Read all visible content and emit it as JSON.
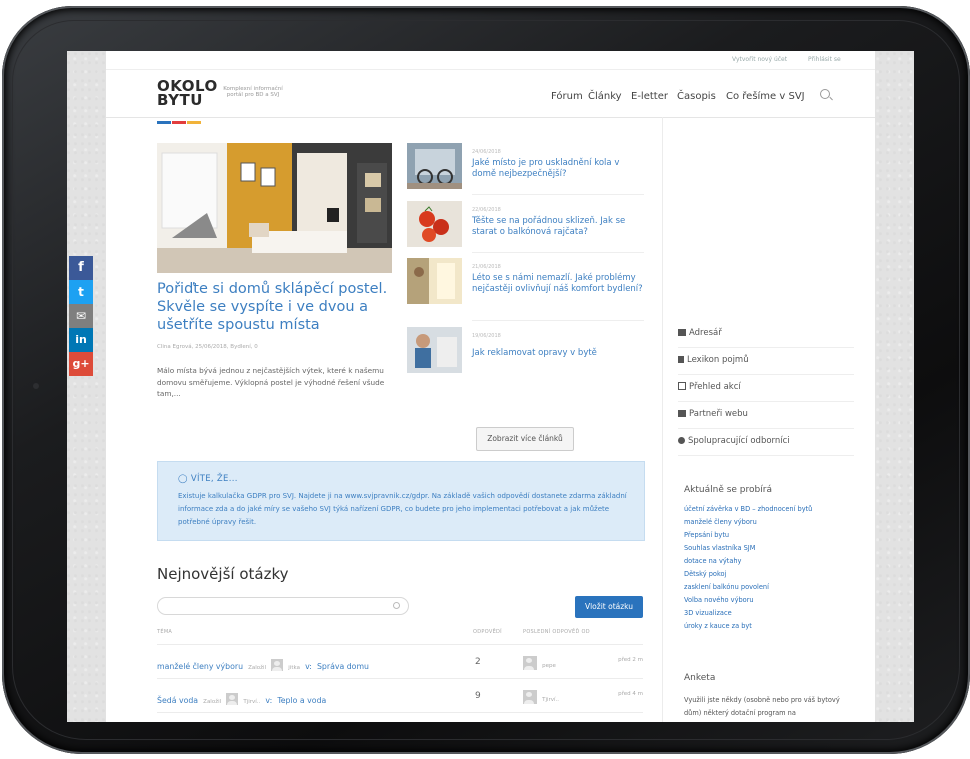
{
  "colors": {
    "accent": "#3d7fc1",
    "button": "#2a73bd",
    "info_bg": "#dcebf8"
  },
  "topbar": {
    "register": "Vytvořit nový účet",
    "login": "Přihlásit se"
  },
  "header": {
    "logo_line1": "OKOLO",
    "logo_line2": "BYTU",
    "tagline": "Komplexní informační portál pro BD a SVJ",
    "nav": [
      "Fórum",
      "Články",
      "E-letter",
      "Časopis",
      "Co řešíme v SVJ"
    ]
  },
  "featured": {
    "title": "Pořiďte si domů sklápěcí postel. Skvěle se vyspíte i ve dvou a ušetříte spoustu místa",
    "meta": "Clina Egrová, 25/06/2018, Bydlení, 0",
    "excerpt": "Málo místa bývá jednou z nejčastějších výtek, které k našemu domovu směřujeme. Výklopná postel je výhodné řešení všude tam,..."
  },
  "articles": [
    {
      "date": "24/06/2018",
      "title": "Jaké místo je pro uskladnění kola v domě nejbezpečnější?"
    },
    {
      "date": "22/06/2018",
      "title": "Těšte se na pořádnou sklizeň. Jak se starat o balkónová rajčata?"
    },
    {
      "date": "21/06/2018",
      "title": "Léto se s námi nemazlí. Jaké problémy nejčastěji ovlivňují náš komfort bydlení?"
    },
    {
      "date": "19/06/2018",
      "title": "Jak reklamovat opravy v bytě"
    }
  ],
  "more_button": "Zobrazit více článků",
  "info": {
    "title": "VÍTE, ŽE...",
    "text": "Existuje kalkulačka GDPR pro SVJ. Najdete ji na www.svjpravnik.cz/gdpr. Na základě vašich odpovědí dostanete zdarma základní informace zda a do jaké míry se vašeho SVJ týká nařízení GDPR, co budete pro jeho implementaci potřebovat a jak můžete potřebné úpravy řešit."
  },
  "questions": {
    "title": "Nejnovější otázky",
    "button": "Vložit otázku",
    "headers": {
      "topic": "TÉMA",
      "answers": "ODPOVĚDÍ",
      "last": "POSLEDNÍ ODPOVĚĎ OD"
    },
    "rows": [
      {
        "topic": "manželé členy výboru",
        "started_by": "Založil",
        "author": "jitka",
        "in": "v:",
        "forum": "Správa domu",
        "answers": "2",
        "last_user": "pepe",
        "ago": "před 2 m"
      },
      {
        "topic": "Šedá voda",
        "started_by": "Založil",
        "author": "Tjirví..",
        "in": "v:",
        "forum": "Teplo a voda",
        "answers": "9",
        "last_user": "Tjirví..",
        "ago": "před 4 m"
      }
    ]
  },
  "sidebar": {
    "links": [
      "Adresář",
      "Lexikon pojmů",
      "Přehled akcí",
      "Partneři webu",
      "Spolupracující odborníci"
    ],
    "trending_title": "Aktuálně se probírá",
    "trending": [
      "účetní závěrka v BD – zhodnocení bytů",
      "manželé členy výboru",
      "Přepsání bytu",
      "Souhlas vlastníka SJM",
      "dotace na výtahy",
      "Dětský pokoj",
      "zasklení balkónu povolení",
      "Volba nového výboru",
      "3D vizualizace",
      "úroky z kauce za byt"
    ],
    "poll_title": "Anketa",
    "poll_text": "Využili jste někdy (osobně nebo pro váš bytový dům) některý dotační program na"
  },
  "share": {
    "icons": [
      "facebook-icon",
      "twitter-icon",
      "email-icon",
      "linkedin-icon",
      "googleplus-icon"
    ],
    "labels": [
      "f",
      "t",
      "✉",
      "in",
      "g+"
    ],
    "colors": [
      "#3b5998",
      "#1da1f2",
      "#7f7f7f",
      "#0077b5",
      "#dd4b39"
    ]
  }
}
